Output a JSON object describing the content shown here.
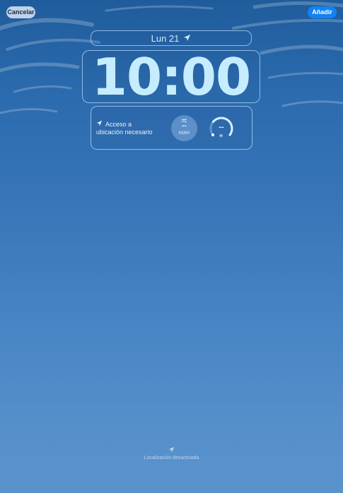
{
  "toolbar": {
    "cancel_label": "Cancelar",
    "add_label": "Añadir"
  },
  "lockscreen": {
    "date": "Lun 21",
    "date_icon": "location-arrow-icon",
    "time": "10:00"
  },
  "widgets": {
    "location_line1": "Acceso a",
    "location_line2": "ubicación necesario",
    "wind_value": "--",
    "wind_unit": "KM/H",
    "uv_value": "--"
  },
  "footer": {
    "text": "Localización desactivada"
  },
  "colors": {
    "add_button": "#1282f5",
    "time_text": "#c6ecff",
    "background_top": "#1f5c9c",
    "background_bottom": "#5a93cc"
  }
}
